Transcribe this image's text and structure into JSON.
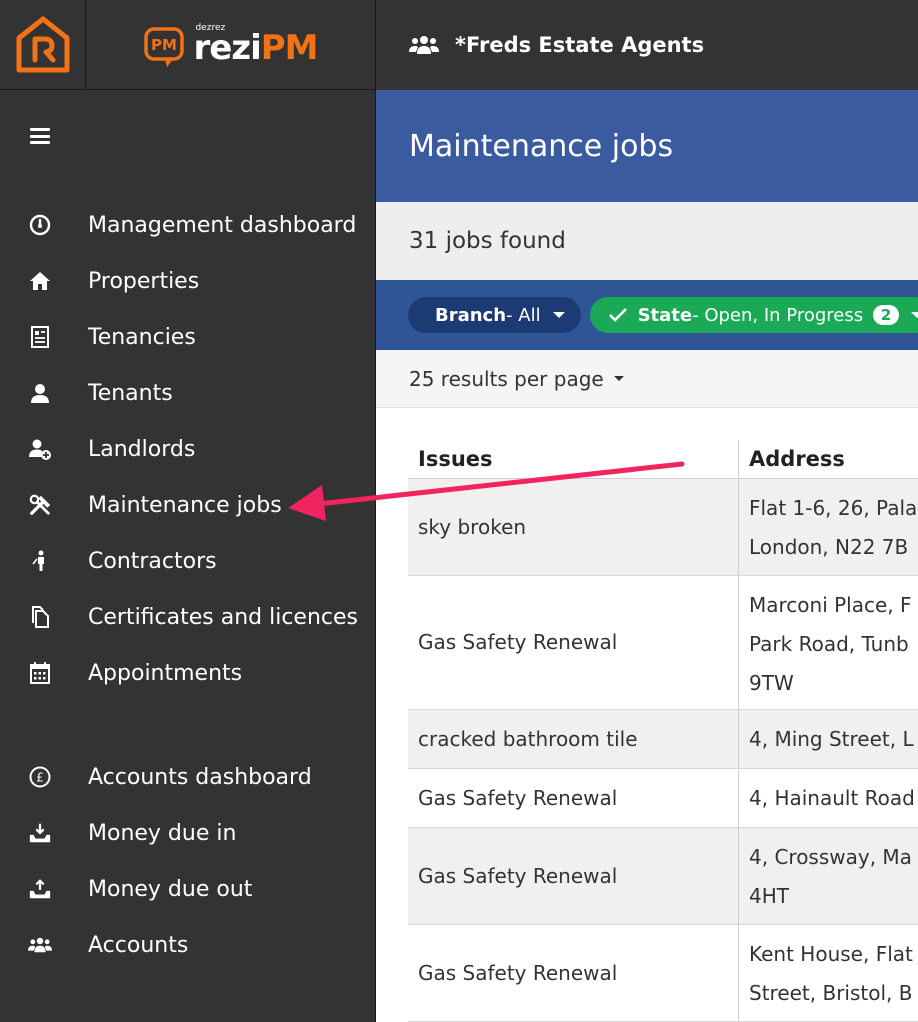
{
  "topbar": {
    "agency_name": "*Freds Estate Agents",
    "icon": "users-icon"
  },
  "logo": {
    "small_text": "dezrez",
    "brand_rezi": "rezi",
    "brand_pm": "PM",
    "box_text": "PM"
  },
  "sidebar": {
    "menu_icon": "hamburger-icon",
    "items": [
      {
        "label": "Management dashboard",
        "icon": "dashboard-gauge-icon"
      },
      {
        "label": "Properties",
        "icon": "home-icon"
      },
      {
        "label": "Tenancies",
        "icon": "document-icon"
      },
      {
        "label": "Tenants",
        "icon": "user-icon"
      },
      {
        "label": "Landlords",
        "icon": "user-plus-icon"
      },
      {
        "label": "Maintenance jobs",
        "icon": "tools-icon"
      },
      {
        "label": "Contractors",
        "icon": "worker-icon"
      },
      {
        "label": "Certificates and licences",
        "icon": "files-icon"
      },
      {
        "label": "Appointments",
        "icon": "calendar-icon"
      }
    ],
    "accounts_items": [
      {
        "label": "Accounts dashboard",
        "icon": "pound-circle-icon"
      },
      {
        "label": "Money due in",
        "icon": "tray-download-icon"
      },
      {
        "label": "Money due out",
        "icon": "tray-upload-icon"
      },
      {
        "label": "Accounts",
        "icon": "users-group-icon"
      }
    ]
  },
  "page": {
    "title": "Maintenance jobs",
    "results_found": "31 jobs found",
    "filters": {
      "branch_key": "Branch",
      "branch_value": " - All",
      "state_key": "State",
      "state_value": " - Open, In Progress",
      "state_count": "2"
    },
    "per_page": "25 results per page"
  },
  "table": {
    "columns": [
      "Issues",
      "Address"
    ],
    "rows": [
      {
        "issue": "sky broken",
        "address": [
          "Flat 1-6, 26, Pala",
          "London, N22 7B"
        ]
      },
      {
        "issue": "Gas Safety Renewal",
        "address": [
          "Marconi Place, F",
          "Park Road, Tunb",
          "9TW"
        ]
      },
      {
        "issue": "cracked bathroom tile",
        "address": [
          "4, Ming Street, L"
        ]
      },
      {
        "issue": "Gas Safety Renewal",
        "address": [
          "4, Hainault Road"
        ]
      },
      {
        "issue": "Gas Safety Renewal",
        "address": [
          "4, Crossway, Ma",
          "4HT"
        ]
      },
      {
        "issue": "Gas Safety Renewal",
        "address": [
          "Kent House, Flat",
          "Street, Bristol, B"
        ]
      }
    ]
  },
  "colors": {
    "sidebar_bg": "#333333",
    "header_blue": "#3a5ba0",
    "filter_blue": "#2f5597",
    "state_green": "#1aaa55",
    "brand_orange": "#f47216",
    "annotation_arrow": "#f0245e"
  }
}
